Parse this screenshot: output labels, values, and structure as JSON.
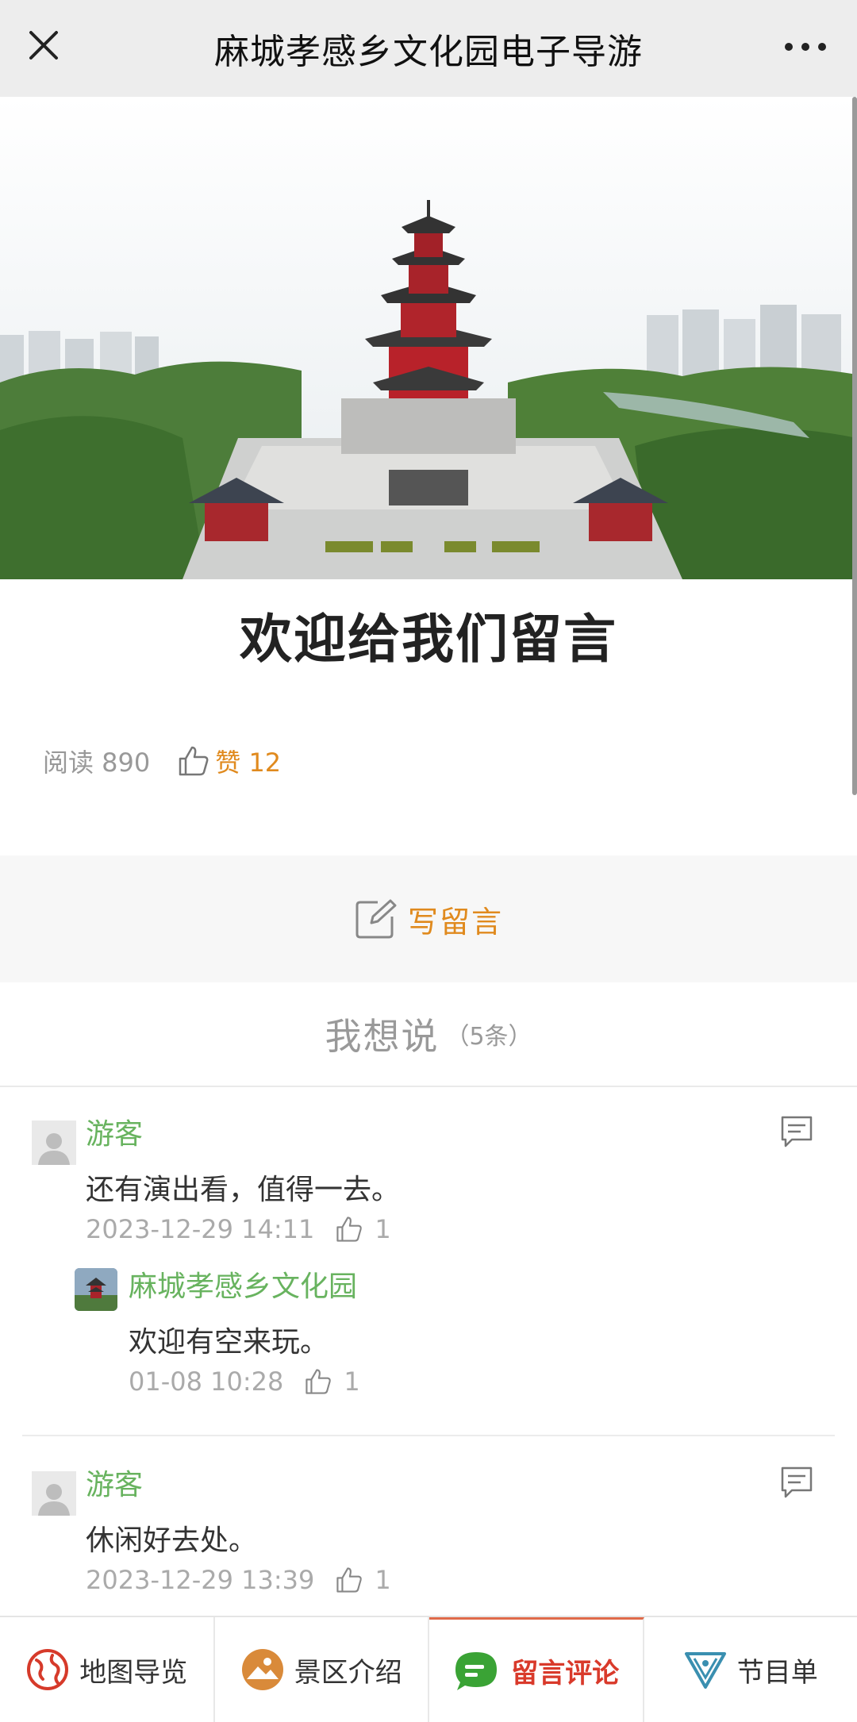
{
  "header": {
    "title": "麻城孝感乡文化园电子导游"
  },
  "article": {
    "headline": "欢迎给我们留言",
    "read_label": "阅读 890",
    "like_label": "赞 12"
  },
  "write": {
    "label": "写留言"
  },
  "comments_section": {
    "title": "我想说",
    "count": "（5条）"
  },
  "comments": [
    {
      "name": "游客",
      "text": "还有演出看，值得一去。",
      "time": "2023-12-29 14:11",
      "likes": "1",
      "reply": {
        "name": "麻城孝感乡文化园",
        "text": "欢迎有空来玩。",
        "time": "01-08 10:28",
        "likes": "1"
      }
    },
    {
      "name": "游客",
      "text": "休闲好去处。",
      "time": "2023-12-29 13:39",
      "likes": "1"
    }
  ],
  "bottom_nav": [
    {
      "label": "地图导览",
      "icon": "map-globe-icon"
    },
    {
      "label": "景区介绍",
      "icon": "scenic-intro-icon"
    },
    {
      "label": "留言评论",
      "icon": "chat-bubble-icon",
      "active": true
    },
    {
      "label": "节目单",
      "icon": "program-list-icon"
    }
  ],
  "colors": {
    "accent_orange": "#e08a1e",
    "name_green": "#68b35f",
    "active_red": "#d93a2b"
  }
}
